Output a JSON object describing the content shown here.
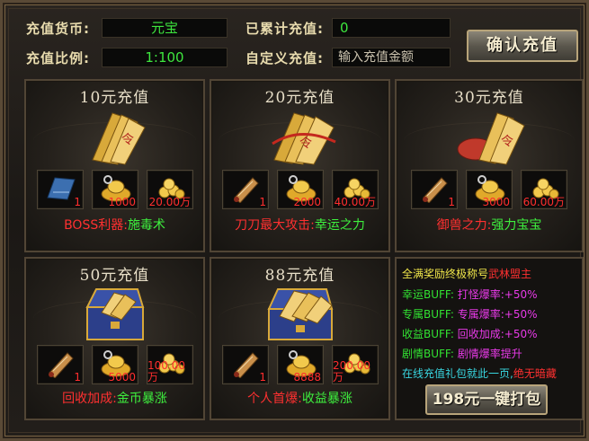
{
  "header": {
    "currency_label": "充值货币:",
    "currency_value": "元宝",
    "ratio_label": "充值比例:",
    "ratio_value": "1:100",
    "total_label": "已累计充值:",
    "total_value": "0",
    "custom_label": "自定义充值:",
    "custom_placeholder": "输入充值金额",
    "confirm_label": "确认充值"
  },
  "tiers": [
    {
      "title": "10元充值",
      "items": [
        {
          "icon": "skill-book-icon",
          "qty": "1"
        },
        {
          "icon": "gold-ingot-icon",
          "qty": "1000"
        },
        {
          "icon": "gold-coins-icon",
          "qty": "20.00万"
        }
      ],
      "desc_red": "BOSS利器:",
      "desc_green": "施毒术"
    },
    {
      "title": "20元充值",
      "items": [
        {
          "icon": "scroll-icon",
          "qty": "1"
        },
        {
          "icon": "gold-ingot-icon",
          "qty": "2000"
        },
        {
          "icon": "gold-coins-icon",
          "qty": "40.00万"
        }
      ],
      "desc_red": "刀刀最大攻击:",
      "desc_green": "幸运之力"
    },
    {
      "title": "30元充值",
      "items": [
        {
          "icon": "scroll-icon",
          "qty": "1"
        },
        {
          "icon": "gold-ingot-icon",
          "qty": "3000"
        },
        {
          "icon": "gold-coins-icon",
          "qty": "60.00万"
        }
      ],
      "desc_red": "御兽之力:",
      "desc_green": "强力宝宝"
    },
    {
      "title": "50元充值",
      "items": [
        {
          "icon": "scroll-icon",
          "qty": "1"
        },
        {
          "icon": "gold-ingot-icon",
          "qty": "5000"
        },
        {
          "icon": "gold-coins-icon",
          "qty": "100.00万"
        }
      ],
      "desc_red": "回收加成:",
      "desc_green": "金币暴涨"
    },
    {
      "title": "88元充值",
      "items": [
        {
          "icon": "scroll-icon",
          "qty": "1"
        },
        {
          "icon": "gold-ingot-icon",
          "qty": "8888"
        },
        {
          "icon": "gold-coins-icon",
          "qty": "200.00万"
        }
      ],
      "desc_red": "个人首爆:",
      "desc_green": "收益暴涨"
    }
  ],
  "bonus": {
    "line1_a": "全满奖励终极称号",
    "line1_b": "武林盟主",
    "rows": [
      {
        "label": "幸运BUFF:",
        "value": "打怪爆率:+50%"
      },
      {
        "label": "专属BUFF:",
        "value": "专属爆率:+50%"
      },
      {
        "label": "收益BUFF:",
        "value": "回收加成:+50%"
      },
      {
        "label": "剧情BUFF:",
        "value": "剧情爆率提升"
      }
    ],
    "note_a": "在线充值礼包就此一页,",
    "note_b": "绝无暗藏",
    "package_label": "198元一键打包"
  },
  "colors": {
    "accent_green": "#3ee63e",
    "accent_red": "#ff3030",
    "title_gold": "#e9dcae"
  }
}
